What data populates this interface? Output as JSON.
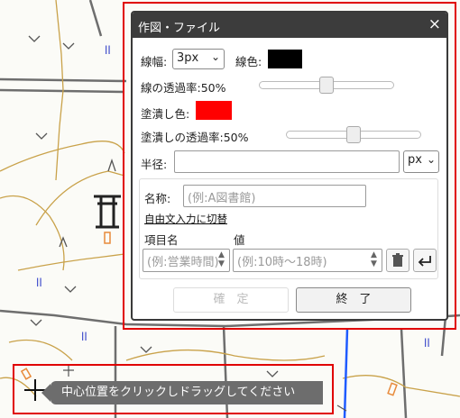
{
  "dialog": {
    "title": "作図・ファイル",
    "close_glyph": "×",
    "line_width_label": "線幅:",
    "line_width_value": "3px",
    "line_color_label": "線色:",
    "line_color": "#000000",
    "line_opacity_label": "線の透過率:50%",
    "line_opacity": 0.5,
    "fill_color_label": "塗潰し色:",
    "fill_color": "#ff0000",
    "fill_opacity_label": "塗潰しの透過率:50%",
    "fill_opacity": 0.5,
    "radius_label": "半径:",
    "radius_value": "",
    "radius_unit": "px",
    "name_label": "名称:",
    "name_placeholder": "(例:A図書館)",
    "free_text_link": "自由文入力に切替",
    "item_name_header": "項目名",
    "value_header": "値",
    "item_name_placeholder": "(例:営業時間)",
    "value_placeholder": "(例:10時〜18時)",
    "confirm_label": "確　定",
    "finish_label": "終　了"
  },
  "hint": {
    "text": "中心位置をクリックしドラッグしてください"
  },
  "colors": {
    "highlight": "#e00000",
    "titlebar": "#3c3c3c",
    "hint_bg": "#6d6d6d"
  }
}
